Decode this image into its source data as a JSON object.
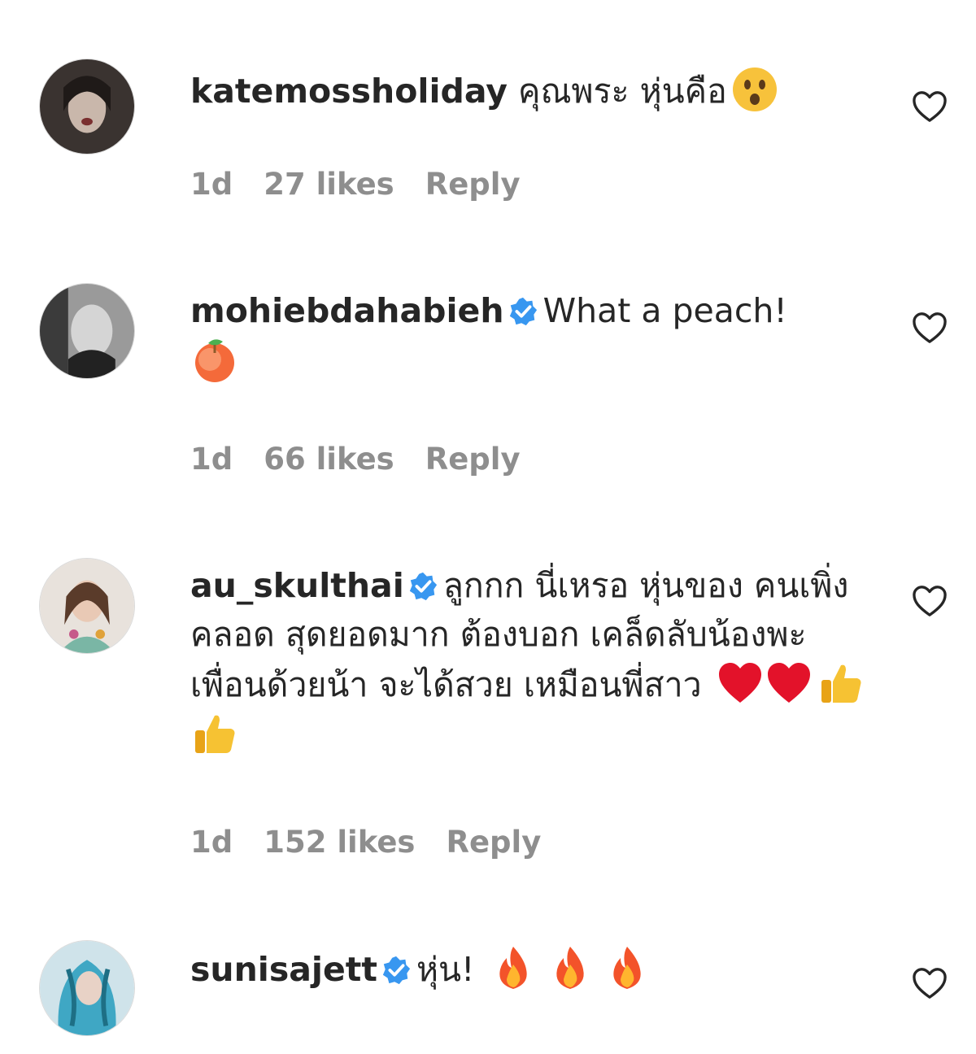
{
  "comments": [
    {
      "username": "katemossholiday",
      "verified": false,
      "text": "คุณพระ หุ่นคือ",
      "emojis": [
        "astonished-face-emoji"
      ],
      "time": "1d",
      "likes": "27 likes",
      "reply": "Reply"
    },
    {
      "username": "mohiebdahabieh",
      "verified": true,
      "text": "What a peach!",
      "emojis": [
        "peach-emoji"
      ],
      "time": "1d",
      "likes": "66 likes",
      "reply": "Reply"
    },
    {
      "username": "au_skulthai",
      "verified": true,
      "text": "ลูกกก นี่เหรอ หุ่นของ คนเพิ่งคลอด สุดยอดมาก ต้องบอก เคล็ดลับน้องพะเพื่อนด้วยน้า จะได้สวย เหมือนพี่สาว",
      "emojis": [
        "red-heart-emoji",
        "red-heart-emoji",
        "thumbs-up-emoji",
        "thumbs-up-emoji"
      ],
      "time": "1d",
      "likes": "152 likes",
      "reply": "Reply"
    },
    {
      "username": "sunisajett",
      "verified": true,
      "text": "หุ่น!",
      "emojis": [
        "fire-emoji",
        "fire-emoji",
        "fire-emoji"
      ],
      "time": "",
      "likes": "",
      "reply": ""
    }
  ],
  "icons": {
    "like": "heart-outline-icon",
    "verified": "verified-badge-icon"
  },
  "colors": {
    "text": "#262626",
    "meta": "#8e8e8e",
    "verified": "#3897f0"
  }
}
